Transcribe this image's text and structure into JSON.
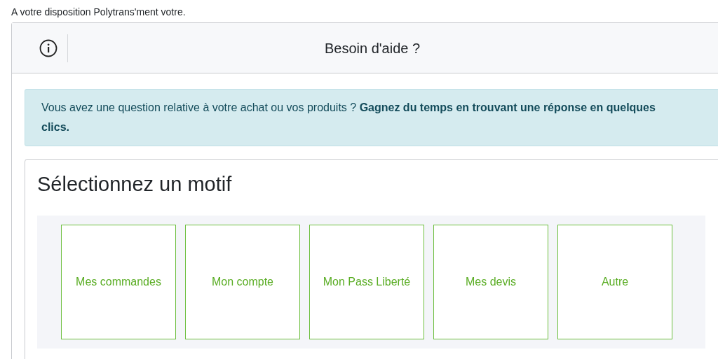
{
  "intro": "A votre disposition Polytrans'ment votre.",
  "header": {
    "title": "Besoin d'aide ?"
  },
  "alert": "Vous avez une question relative à votre achat ou vos produits ? **Gagnez du temps en trouvant une réponse en quelques clics.**",
  "motifs": {
    "heading": "Sélectionnez un motif",
    "options": [
      {
        "label": "Mes commandes"
      },
      {
        "label": "Mon compte"
      },
      {
        "label": "Mon Pass Liberté"
      },
      {
        "label": "Mes devis"
      },
      {
        "label": "Autre"
      }
    ]
  }
}
